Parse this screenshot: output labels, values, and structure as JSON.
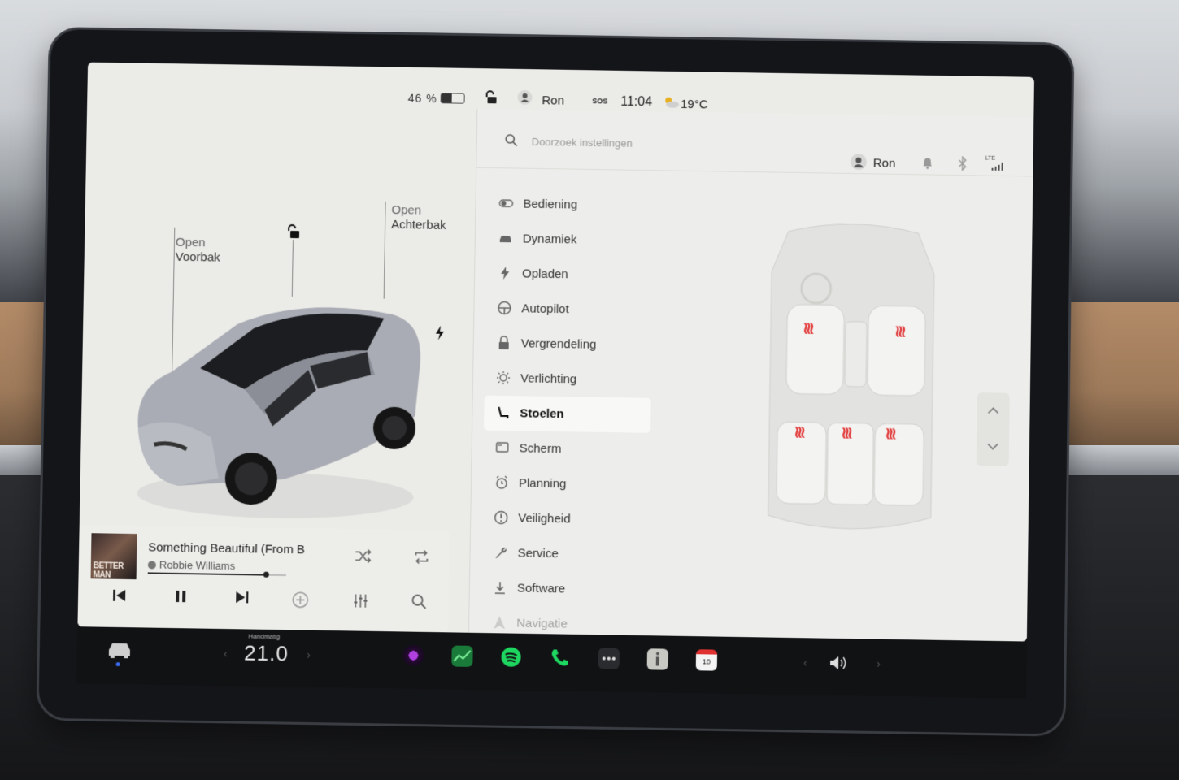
{
  "status": {
    "battery_pct": "46 %",
    "battery_level": 0.46,
    "user": "Ron",
    "sos": "SOS",
    "time": "11:04",
    "outside_temp": "19°C"
  },
  "car": {
    "frunk_label_1": "Open",
    "frunk_label_2": "Voorbak",
    "trunk_label_1": "Open",
    "trunk_label_2": "Achterbak",
    "color": "#a9acb4"
  },
  "media": {
    "title": "Something Beautiful (From B",
    "artist": "Robbie Williams",
    "album_text": "BETTER MAN",
    "progress": 0.85
  },
  "settings": {
    "search_placeholder": "Doorzoek instellingen",
    "user": "Ron",
    "lte": "LTE",
    "menu": [
      {
        "label": "Bediening",
        "icon": "toggle-icon"
      },
      {
        "label": "Dynamiek",
        "icon": "car-icon"
      },
      {
        "label": "Opladen",
        "icon": "bolt-icon"
      },
      {
        "label": "Autopilot",
        "icon": "steering-wheel-icon"
      },
      {
        "label": "Vergrendeling",
        "icon": "lock-icon"
      },
      {
        "label": "Verlichting",
        "icon": "sun-icon"
      },
      {
        "label": "Stoelen",
        "icon": "seat-icon"
      },
      {
        "label": "Scherm",
        "icon": "screen-icon"
      },
      {
        "label": "Planning",
        "icon": "alarm-icon"
      },
      {
        "label": "Veiligheid",
        "icon": "alert-icon"
      },
      {
        "label": "Service",
        "icon": "wrench-icon"
      },
      {
        "label": "Software",
        "icon": "download-icon"
      },
      {
        "label": "Navigatie",
        "icon": "navigation-icon"
      }
    ],
    "active_index": 6,
    "heat_color": "#e23a3a"
  },
  "taskbar": {
    "climate_mode": "Handmatig",
    "cabin_temp": "21.0",
    "calendar_day": "10"
  }
}
